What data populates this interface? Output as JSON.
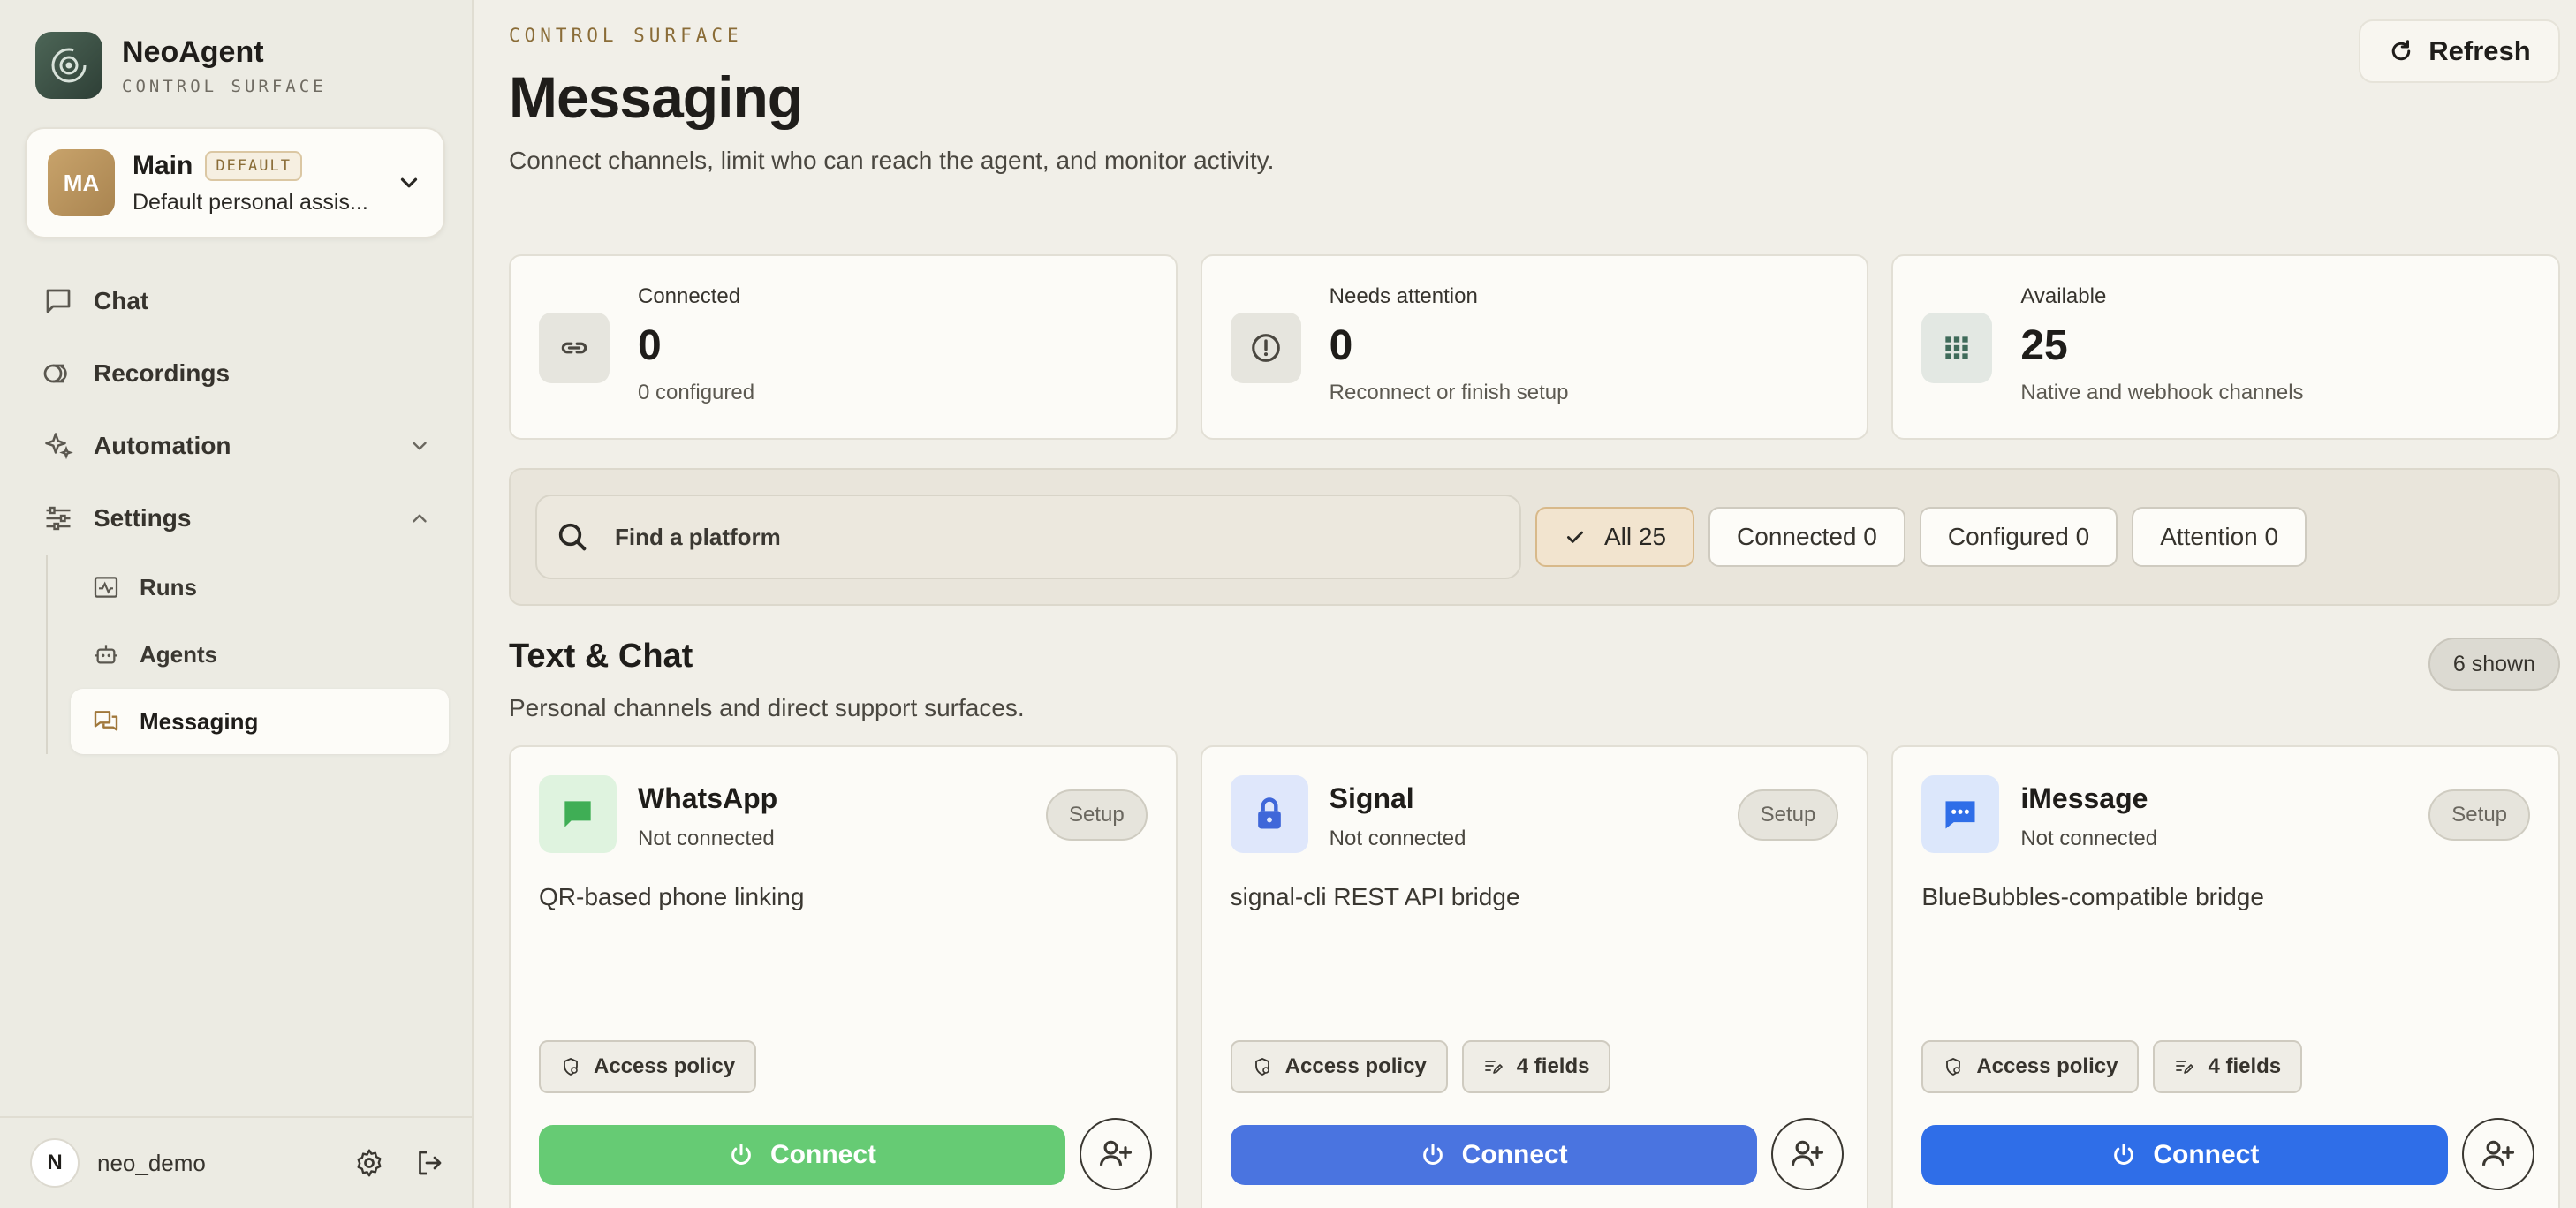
{
  "brand": {
    "name": "NeoAgent",
    "subtitle": "CONTROL SURFACE"
  },
  "agent": {
    "initials": "MA",
    "name": "Main",
    "badge": "DEFAULT",
    "description": "Default personal assis..."
  },
  "nav": {
    "chat": "Chat",
    "recordings": "Recordings",
    "automation": "Automation",
    "settings": "Settings",
    "sub": {
      "runs": "Runs",
      "agents": "Agents",
      "messaging": "Messaging"
    }
  },
  "user": {
    "initial": "N",
    "name": "neo_demo"
  },
  "header": {
    "eyebrow": "CONTROL SURFACE",
    "title": "Messaging",
    "subtitle": "Connect channels, limit who can reach the agent, and monitor activity.",
    "refresh_label": "Refresh"
  },
  "stats": [
    {
      "label": "Connected",
      "value": "0",
      "hint": "0 configured",
      "icon": "link-icon"
    },
    {
      "label": "Needs attention",
      "value": "0",
      "hint": "Reconnect or finish setup",
      "icon": "alert-circle-icon"
    },
    {
      "label": "Available",
      "value": "25",
      "hint": "Native and webhook channels",
      "icon": "grid-icon"
    }
  ],
  "filters": {
    "search_placeholder": "Find a platform",
    "chips": [
      "All 25",
      "Connected 0",
      "Configured 0",
      "Attention 0"
    ],
    "active_chip": "All 25"
  },
  "section": {
    "title": "Text & Chat",
    "subtitle": "Personal channels and direct support surfaces.",
    "shown": "6 shown"
  },
  "cards": [
    {
      "name": "WhatsApp",
      "status": "Not connected",
      "setup": "Setup",
      "description": "QR-based phone linking",
      "tags": [
        "Access policy"
      ],
      "connect": "Connect",
      "icon": "chat-bubble-icon",
      "accent": "#66cb74",
      "icon_bg": "#dff3df"
    },
    {
      "name": "Signal",
      "status": "Not connected",
      "setup": "Setup",
      "description": "signal-cli REST API bridge",
      "tags": [
        "Access policy",
        "4 fields"
      ],
      "connect": "Connect",
      "icon": "lock-icon",
      "accent": "#4a74e0",
      "icon_bg": "#dfe7fb"
    },
    {
      "name": "iMessage",
      "status": "Not connected",
      "setup": "Setup",
      "description": "BlueBubbles-compatible bridge",
      "tags": [
        "Access policy",
        "4 fields"
      ],
      "connect": "Connect",
      "icon": "message-dots-icon",
      "accent": "#2f6ee8",
      "icon_bg": "#dce7fb"
    }
  ]
}
